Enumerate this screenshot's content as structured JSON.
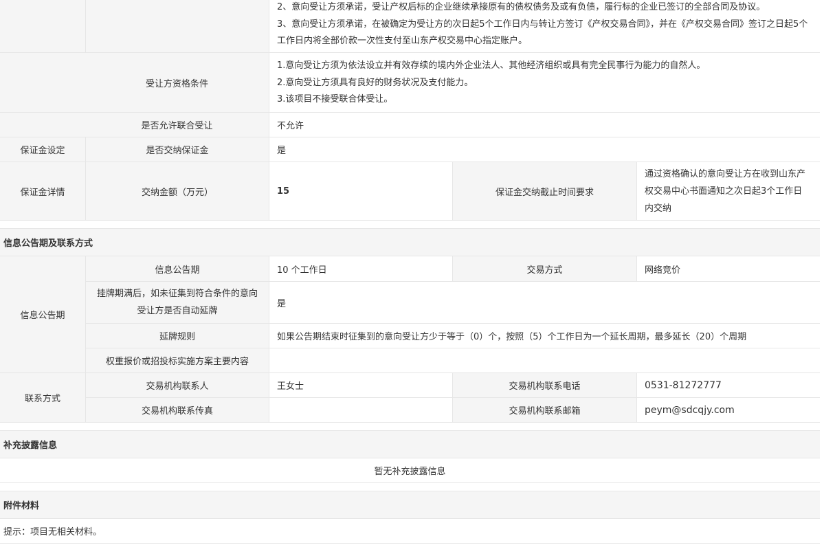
{
  "top": {
    "terms_cont": [
      "2、意向受让方须承诺，受让产权后标的企业继续承接原有的债权债务及或有负债，履行标的企业已签订的全部合同及协议。",
      "3、意向受让方须承诺，在被确定为受让方的次日起5个工作日内与转让方签订《产权交易合同》，并在《产权交易合同》签订之日起5个工作日内将全部价款一次性支付至山东产权交易中心指定账户。"
    ],
    "qualification_label": "受让方资格条件",
    "qualification_lines": [
      "1.意向受让方须为依法设立并有效存续的境内外企业法人、其他经济组织或具有完全民事行为能力的自然人。",
      "2.意向受让方须具有良好的财务状况及支付能力。",
      "3.该项目不接受联合体受让。"
    ],
    "joint_label": "是否允许联合受让",
    "joint_value": "不允许"
  },
  "deposit": {
    "setting_group": "保证金设定",
    "required_label": "是否交纳保证金",
    "required_value": "是",
    "detail_group": "保证金详情",
    "amount_label": "交纳金额（万元）",
    "amount_value": "15",
    "deadline_label": "保证金交纳截止时间要求",
    "deadline_value": "通过资格确认的意向受让方在收到山东产权交易中心书面通知之次日起3个工作日内交纳"
  },
  "announcement": {
    "section_title": "信息公告期及联系方式",
    "group_label": "信息公告期",
    "period_label": "信息公告期",
    "period_value": "10 个工作日",
    "method_label": "交易方式",
    "method_value": "网络竞价",
    "extend_label": "挂牌期满后，如未征集到符合条件的意向受让方是否自动延牌",
    "extend_value": "是",
    "rule_label": "延牌规则",
    "rule_value": "如果公告期结束时征集到的意向受让方少于等于（0）个，按照（5）个工作日为一个延长周期，最多延长（20）个周期",
    "weight_label": "权重报价或招投标实施方案主要内容",
    "weight_value": ""
  },
  "contact": {
    "group_label": "联系方式",
    "person_label": "交易机构联系人",
    "person_value": "王女士",
    "phone_label": "交易机构联系电话",
    "phone_value": "0531-81272777",
    "fax_label": "交易机构联系传真",
    "fax_value": "",
    "email_label": "交易机构联系邮箱",
    "email_value": "peym@sdcqjy.com"
  },
  "supplement": {
    "section_title": "补充披露信息",
    "empty_text": "暂无补充披露信息"
  },
  "attachments": {
    "section_title": "附件材料",
    "note_text": "提示：项目无相关材料。"
  }
}
